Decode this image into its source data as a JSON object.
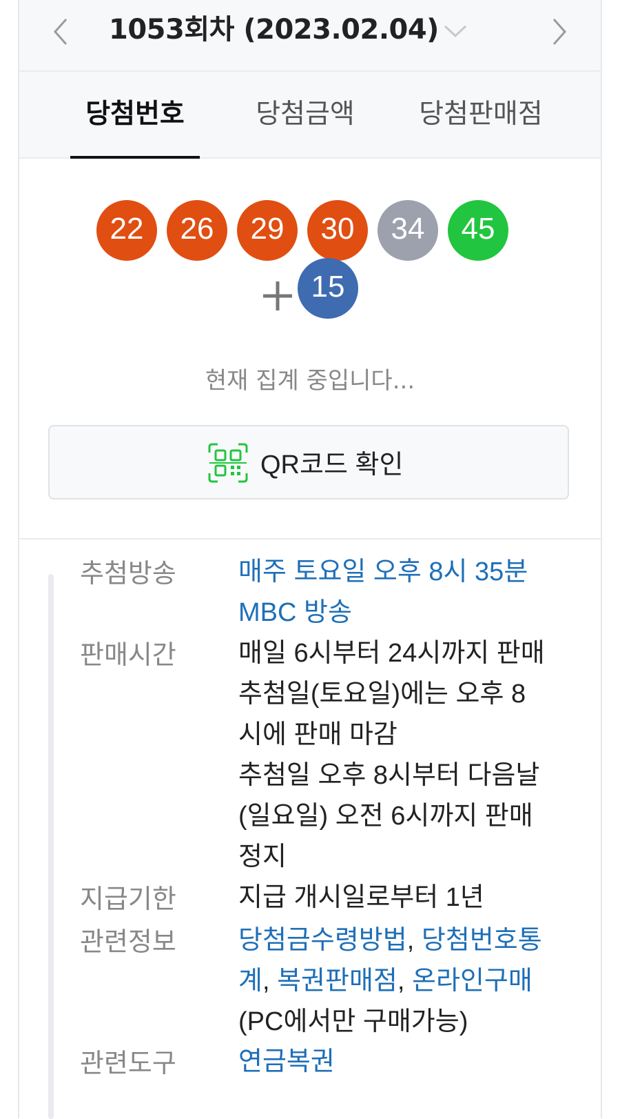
{
  "header": {
    "round_title": "1053회차 (2023.02.04)",
    "prev_icon": "chevron-left-icon",
    "next_icon": "chevron-right-icon",
    "dropdown_icon": "chevron-down-icon"
  },
  "tabs": [
    {
      "label": "당첨번호",
      "active": true
    },
    {
      "label": "당첨금액",
      "active": false
    },
    {
      "label": "당첨판매점",
      "active": false
    }
  ],
  "winning_numbers": [
    {
      "number": "22",
      "color": "#e04e12"
    },
    {
      "number": "26",
      "color": "#e04e12"
    },
    {
      "number": "29",
      "color": "#e04e12"
    },
    {
      "number": "30",
      "color": "#e04e12"
    },
    {
      "number": "34",
      "color": "#9da0ad"
    },
    {
      "number": "45",
      "color": "#22c53f"
    }
  ],
  "bonus_number": {
    "number": "15",
    "color": "#3f6bb0"
  },
  "status_text": "현재 집계 중입니다...",
  "qr_button": {
    "label": "QR코드 확인",
    "icon": "qr-code-icon"
  },
  "info": {
    "broadcast": {
      "label": "추첨방송",
      "lines": [
        "매주 토요일 오후 8시 35분",
        "MBC 방송"
      ]
    },
    "sales_time": {
      "label": "판매시간",
      "lines": [
        "매일 6시부터 24시까지 판매",
        "추첨일(토요일)에는 오후 8",
        "시에 판매 마감",
        "추첨일 오후 8시부터 다음날",
        "(일요일) 오전 6시까지 판매",
        "정지"
      ]
    },
    "payment_deadline": {
      "label": "지급기한",
      "value": "지급 개시일로부터 1년"
    },
    "related_info": {
      "label": "관련정보",
      "link1": "당첨금수령방법",
      "sep1": ", ",
      "link2a": "당첨번호통",
      "link2b": "계",
      "sep2": ", ",
      "link3": "복권판매점",
      "sep3": ", ",
      "link4": "온라인구매",
      "note": "(PC에서만 구매가능)"
    },
    "related_tools": {
      "label": "관련도구",
      "link": "연금복권"
    }
  },
  "colors": {
    "link": "#1e6fb8",
    "ball_orange": "#e04e12",
    "ball_gray": "#9da0ad",
    "ball_green": "#22c53f",
    "ball_blue": "#3f6bb0",
    "qr_green": "#22c53f"
  }
}
